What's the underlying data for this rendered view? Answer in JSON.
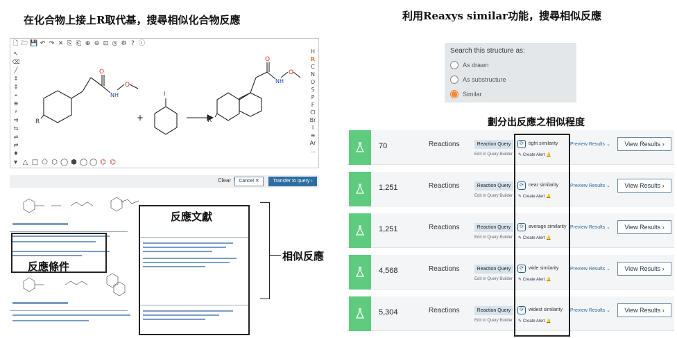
{
  "headings": {
    "left": "在化合物上接上R取代基，搜尋相似化合物反應",
    "right": "利用Reaxys similar功能，搜尋相似反應",
    "similarity_grade": "劃分出反應之相似程度"
  },
  "editor": {
    "top_toolbar_icons": [
      "new-icon",
      "open-icon",
      "save-icon",
      "undo-icon",
      "redo-icon",
      "cut-icon",
      "copy-icon",
      "paste-icon",
      "zoom-in-icon",
      "zoom-out-icon",
      "zoom-fit-icon",
      "view-icon",
      "settings-icon",
      "help-icon",
      "info-icon"
    ],
    "top_toolbar_glyphs": [
      "🗋",
      "🗁",
      "💾",
      "↶",
      "↷",
      "✕",
      "⎘",
      "⎗",
      "⊕",
      "⊖",
      "⊡",
      "◎",
      "⚙",
      "?",
      "ⓘ"
    ],
    "left_toolbar_glyphs": [
      "↖",
      "⌫",
      "╱",
      "↕",
      "↕",
      "⌖",
      "⊕",
      "⚡",
      "⇉",
      "⇆",
      "⇌",
      "⇄",
      "♦"
    ],
    "right_toolbar": [
      "H",
      "R",
      "C",
      "N",
      "O",
      "S",
      "P",
      "F",
      "Cl",
      "Br",
      "I",
      "≡",
      "Ar",
      "…"
    ],
    "bottom_toolbar_glyphs": [
      "△",
      "□",
      "⬠",
      "⬡",
      "◯",
      "⬢",
      "◯",
      "◯",
      "⌬",
      "⌬"
    ],
    "structure_labels": {
      "o1": "O",
      "nh1": "N",
      "h1": "H",
      "o2": "O",
      "r1": "R",
      "iodine": "I",
      "o3": "O",
      "nh2": "N",
      "h2": "H",
      "o4": "O",
      "r2": "R",
      "plus": "+"
    },
    "clear_label": "Clear",
    "cancel_label": "Cancel ✕",
    "transfer_label": "Transfer to query ›"
  },
  "literature": {
    "frame_title": "反應文獻",
    "conditions_title": "反應條件",
    "similar_label": "相似反應"
  },
  "search_structure": {
    "title": "Search this structure as:",
    "options": [
      {
        "label": "As drawn",
        "selected": false
      },
      {
        "label": "As substructure",
        "selected": false
      },
      {
        "label": "Similar",
        "selected": true
      }
    ]
  },
  "results": [
    {
      "count": "70",
      "type": "Reactions",
      "query_button": "Reaction Query",
      "edit_link": "Edit in Query Builder",
      "similarity": "tight similarity",
      "alert": "Create Alert",
      "preview": "Preview Results",
      "view": "View Results"
    },
    {
      "count": "1,251",
      "type": "Reactions",
      "query_button": "Reaction Query",
      "edit_link": "Edit in Query Builder",
      "similarity": "near similarity",
      "alert": "Create Alert",
      "preview": "Preview Results",
      "view": "View Results"
    },
    {
      "count": "1,251",
      "type": "Reactions",
      "query_button": "Reaction Query",
      "edit_link": "Edit in Query Builder",
      "similarity": "average similarity",
      "alert": "Create Alert",
      "preview": "Preview Results",
      "view": "View Results"
    },
    {
      "count": "4,568",
      "type": "Reactions",
      "query_button": "Reaction Query",
      "edit_link": "Edit in Query Builder",
      "similarity": "wide similarity",
      "alert": "Create Alert",
      "preview": "Preview Results",
      "view": "View Results"
    },
    {
      "count": "5,304",
      "type": "Reactions",
      "query_button": "Reaction Query",
      "edit_link": "Edit in Query Builder",
      "similarity": "widest similarity",
      "alert": "Create Alert",
      "preview": "Preview Results",
      "view": "View Results"
    }
  ],
  "colors": {
    "flask_green": "#5fcb7f",
    "accent_blue": "#2c6ea0",
    "radio_orange": "#f28a2e"
  }
}
